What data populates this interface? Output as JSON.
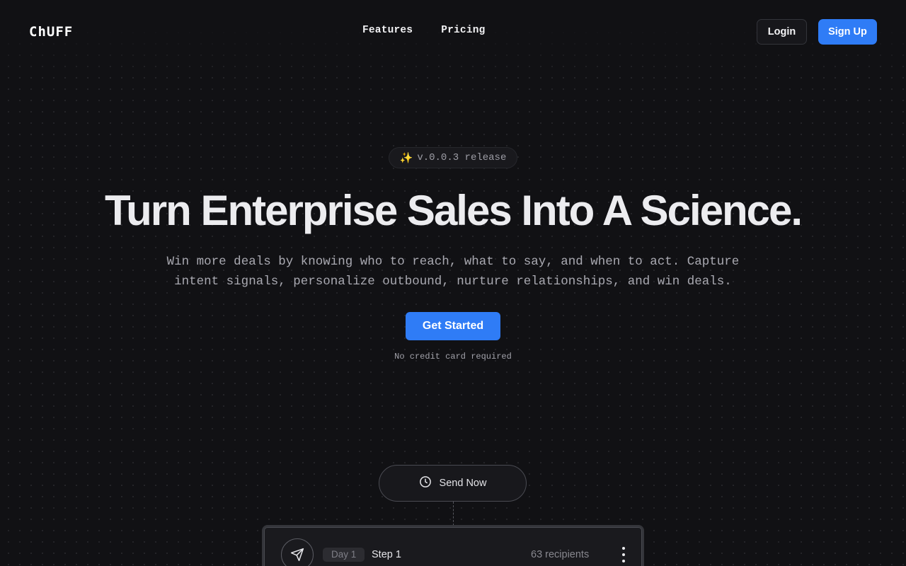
{
  "nav": {
    "logo": "ChUFF",
    "links": [
      "Features",
      "Pricing"
    ],
    "login_label": "Login",
    "signup_label": "Sign Up"
  },
  "hero": {
    "badge": "v.0.0.3 release",
    "title": "Turn Enterprise Sales Into A Science.",
    "subtitle": "Win more deals by knowing who to reach, what to say, and when to act. Capture intent signals, personalize outbound, nurture relationships, and win deals.",
    "cta_label": "Get Started",
    "note": "No credit card required"
  },
  "flow": {
    "send_label": "Send Now",
    "step": {
      "day": "Day 1",
      "label": "Step 1",
      "recipients": "63 recipients"
    }
  },
  "colors": {
    "background": "#111114",
    "accent": "#2f7cf6",
    "text": "#ececef",
    "muted": "#a9a9b1"
  },
  "icons": {
    "badge": "sparkle-icon",
    "send": "clock-icon",
    "step": "paper-plane-icon",
    "menu": "more-vertical-icon"
  }
}
